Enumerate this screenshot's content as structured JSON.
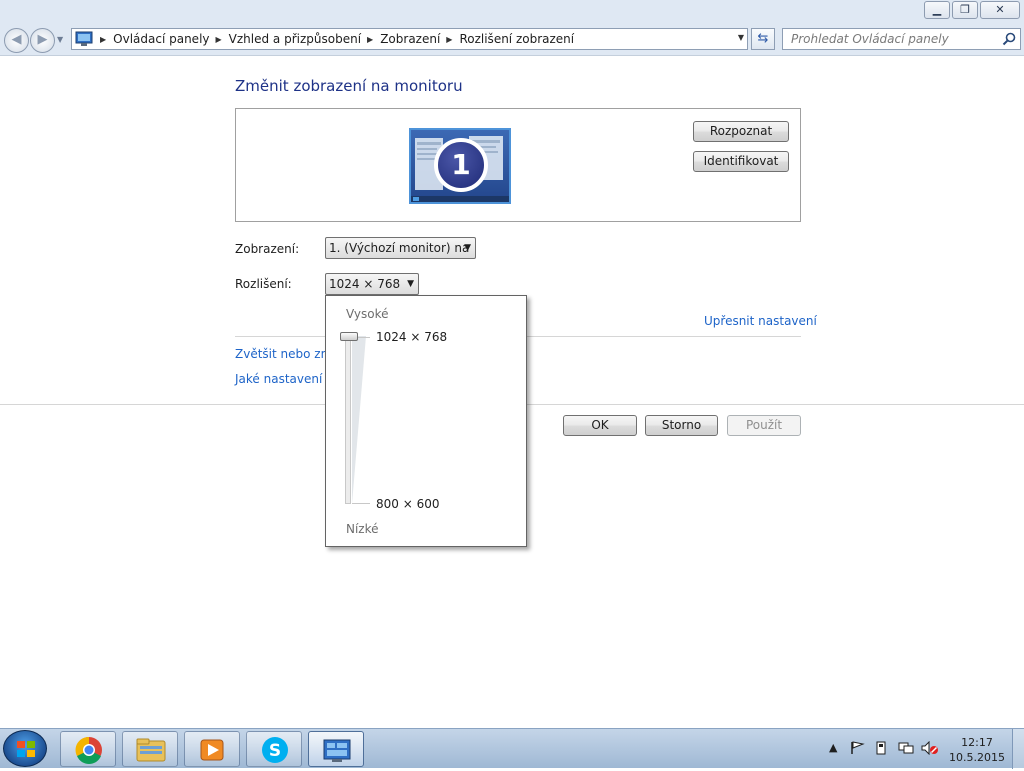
{
  "window": {
    "minimize_glyph": "▁",
    "maximize_glyph": "❐",
    "close_glyph": "✕"
  },
  "address_bar": {
    "breadcrumbs": [
      {
        "label": "Ovládací panely"
      },
      {
        "label": "Vzhled a přizpůsobení"
      },
      {
        "label": "Zobrazení"
      },
      {
        "label": "Rozlišení zobrazení"
      }
    ],
    "separator": "▶",
    "dropdown_glyph": "▼",
    "refresh_glyph": "⇆"
  },
  "search": {
    "placeholder": "Prohledat Ovládací panely"
  },
  "main": {
    "heading": "Změnit zobrazení na monitoru",
    "monitor_number": "1",
    "detect_button": "Rozpoznat",
    "identify_button": "Identifikovat",
    "display_label": "Zobrazení:",
    "display_value": "1. (Výchozí monitor) na",
    "resolution_label": "Rozlišení:",
    "resolution_value": "1024 × 768",
    "advanced_link": "Upřesnit nastavení",
    "link_enlarge": "Zvětšit nebo zme",
    "link_which_settings": "Jaké nastavení m",
    "ok_button": "OK",
    "cancel_button": "Storno",
    "apply_button": "Použít"
  },
  "resolution_popup": {
    "high_label": "Vysoké",
    "low_label": "Nízké",
    "options": [
      "1024 × 768",
      "800 × 600"
    ],
    "selected_index": 0
  },
  "taskbar": {
    "clock_time": "12:17",
    "clock_date": "10.5.2015",
    "colors": {
      "accent": "#1e64c8",
      "heading": "#1e3287"
    }
  }
}
